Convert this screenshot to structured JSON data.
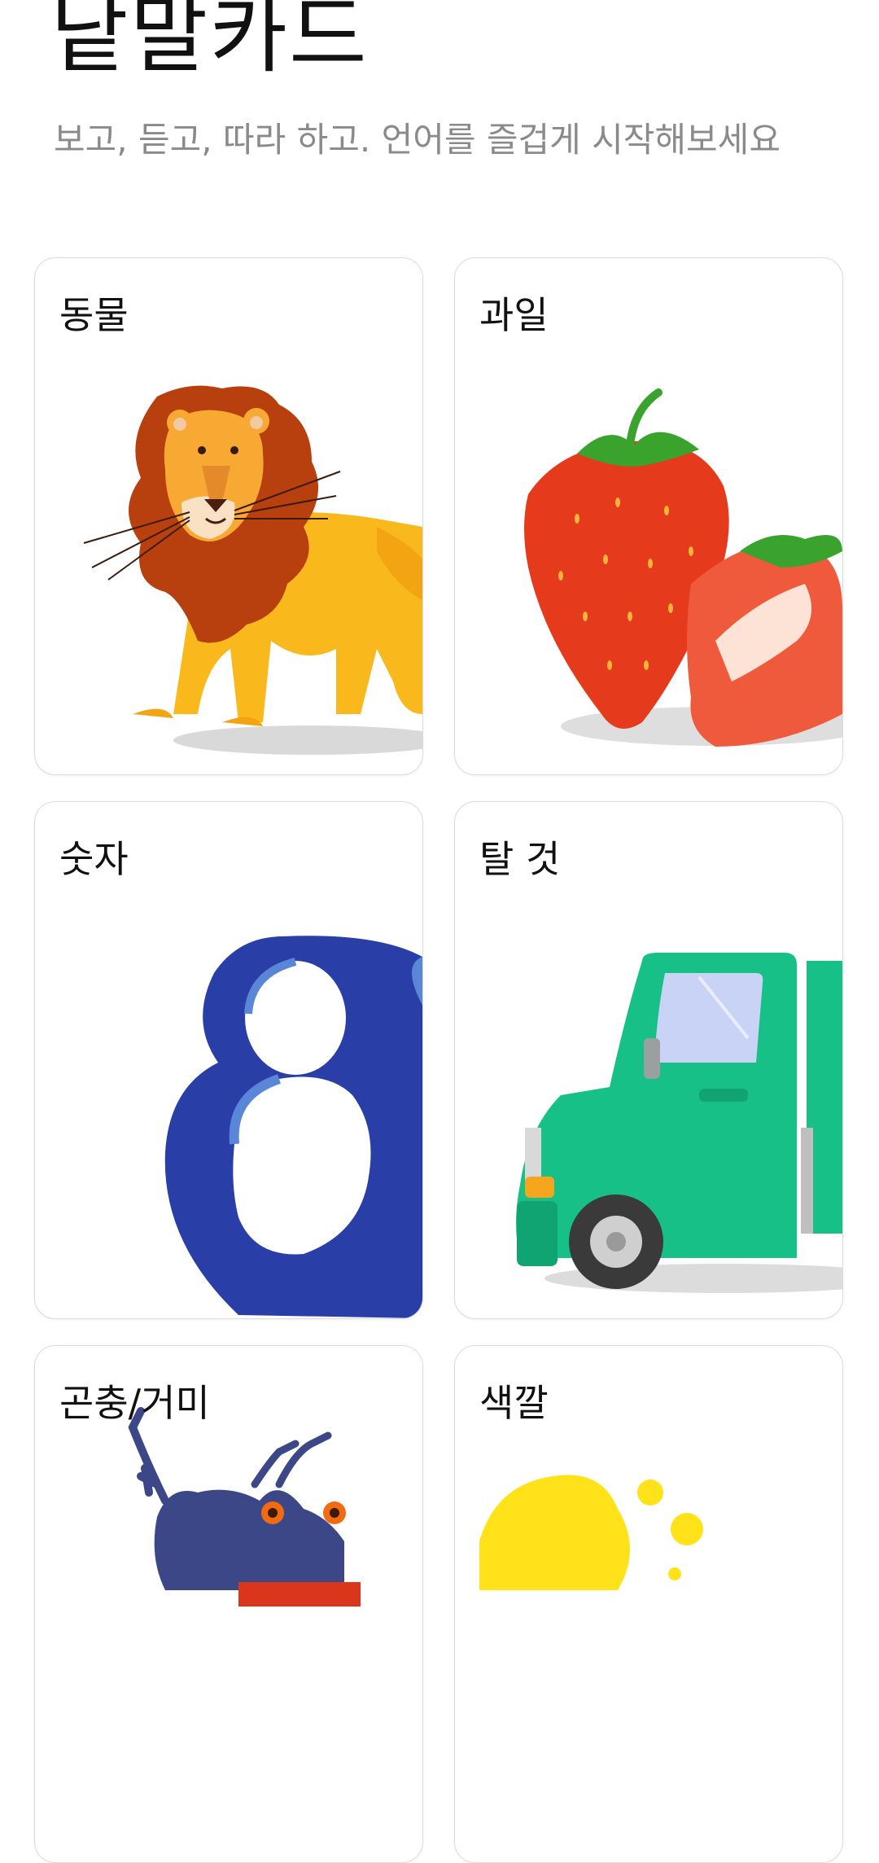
{
  "header": {
    "title": "낱말카드",
    "subtitle": "보고, 듣고, 따라 하고. 언어를 즐겁게 시작해보세요"
  },
  "categories": [
    {
      "label": "동물",
      "icon": "lion-icon"
    },
    {
      "label": "과일",
      "icon": "strawberry-icon"
    },
    {
      "label": "숫자",
      "icon": "number-eight-icon"
    },
    {
      "label": "탈 것",
      "icon": "truck-icon"
    },
    {
      "label": "곤충/거미",
      "icon": "beetle-icon"
    },
    {
      "label": "색깔",
      "icon": "paint-splash-icon"
    }
  ],
  "colors": {
    "lion_mane": "#b8400f",
    "lion_body": "#f9b91c",
    "strawberry": "#e63a1c",
    "eight": "#2a3ea8",
    "truck": "#17c087",
    "beetle": "#3b4786",
    "paint": "#ffe21a"
  }
}
